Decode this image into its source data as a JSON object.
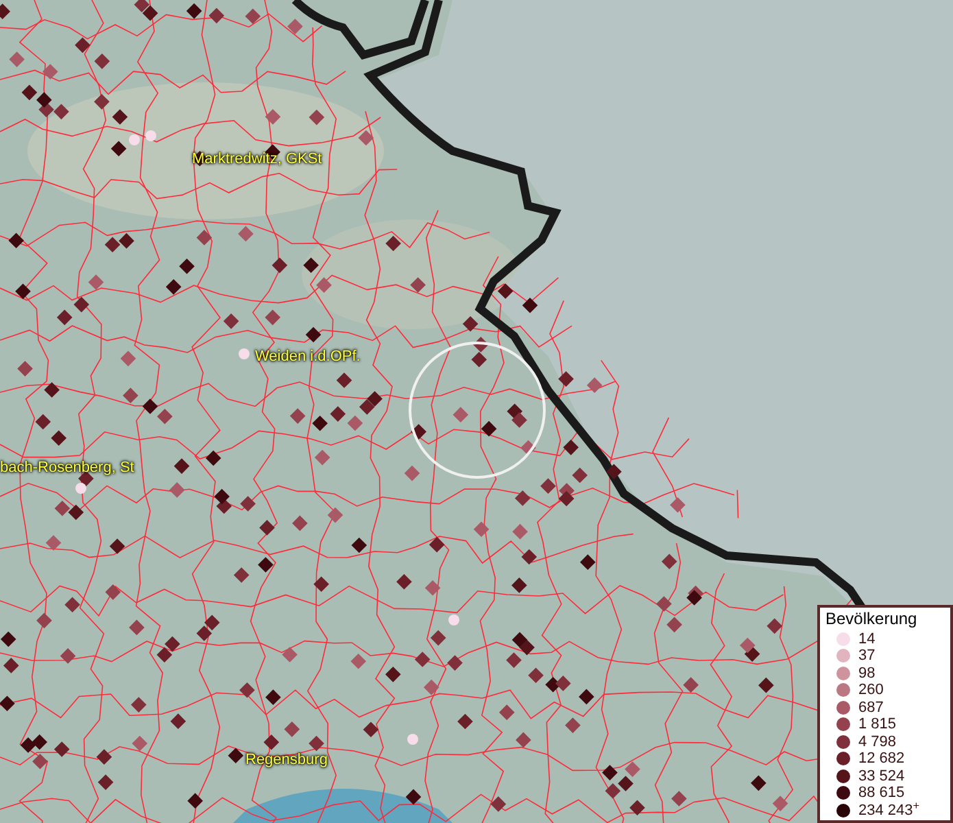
{
  "map_labels": [
    {
      "text": "Marktredwitz, GKSt"
    },
    {
      "text": "Weiden i.d.OPf."
    },
    {
      "text": "bach-Rosenberg, St"
    },
    {
      "text": "Regensburg"
    }
  ],
  "legend": {
    "title": "Bevölkerung",
    "items": [
      {
        "label": "14",
        "color": "#f6dde9"
      },
      {
        "label": "37",
        "color": "#e2b4c0"
      },
      {
        "label": "98",
        "color": "#cf939e"
      },
      {
        "label": "260",
        "color": "#bb7782"
      },
      {
        "label": "687",
        "color": "#a95a66"
      },
      {
        "label": "1 815",
        "color": "#94424d"
      },
      {
        "label": "4 798",
        "color": "#80303a"
      },
      {
        "label": "12 682",
        "color": "#6b1f28"
      },
      {
        "label": "33 524",
        "color": "#55141a"
      },
      {
        "label": "88 615",
        "color": "#3e0a0f"
      },
      {
        "label": "234 243$^{+}$",
        "color": "#2a0507"
      }
    ]
  }
}
